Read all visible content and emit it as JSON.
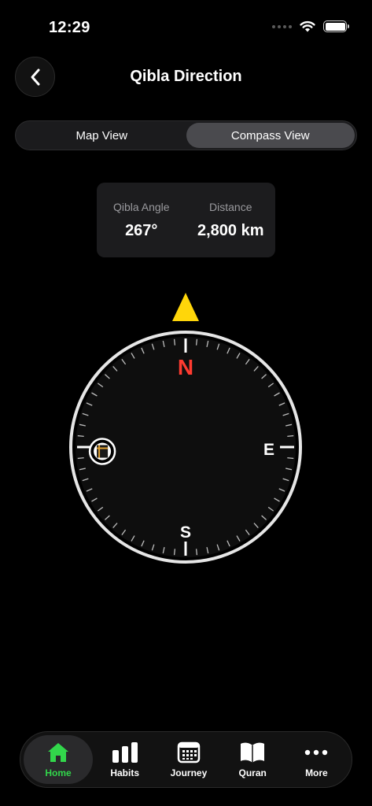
{
  "status_bar": {
    "time": "12:29"
  },
  "header": {
    "title": "Qibla Direction"
  },
  "view_toggle": {
    "options": [
      "Map View",
      "Compass View"
    ],
    "selected": "Compass View"
  },
  "info": {
    "angle_label": "Qibla Angle",
    "angle_value": "267°",
    "distance_label": "Distance",
    "distance_value": "2,800 km"
  },
  "compass": {
    "north": "N",
    "east": "E",
    "south": "S",
    "qibla_bearing_deg": 267,
    "north_color": "#ff3b30",
    "pointer_color": "#ffd60a",
    "qibla_icon": "kaaba-icon"
  },
  "tabs": [
    {
      "label": "Home",
      "icon": "home-icon",
      "active": true
    },
    {
      "label": "Habits",
      "icon": "bar-chart-icon",
      "active": false
    },
    {
      "label": "Journey",
      "icon": "calendar-icon",
      "active": false
    },
    {
      "label": "Quran",
      "icon": "book-icon",
      "active": false
    },
    {
      "label": "More",
      "icon": "more-icon",
      "active": false
    }
  ],
  "colors": {
    "accent_green": "#32d74b",
    "background": "#000000"
  }
}
